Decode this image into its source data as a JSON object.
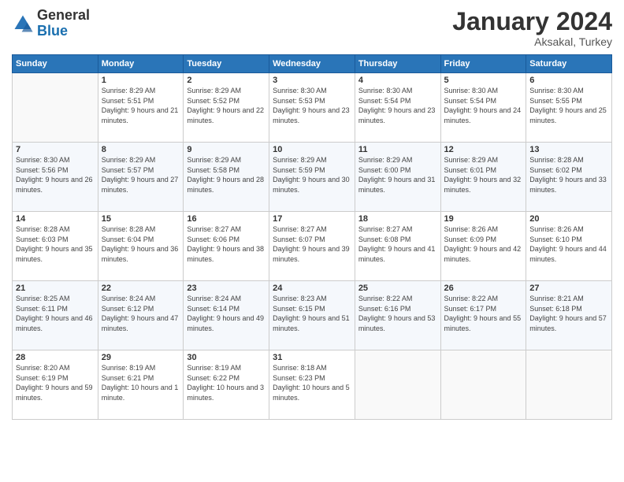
{
  "logo": {
    "general": "General",
    "blue": "Blue"
  },
  "header": {
    "month": "January 2024",
    "location": "Aksakal, Turkey"
  },
  "weekdays": [
    "Sunday",
    "Monday",
    "Tuesday",
    "Wednesday",
    "Thursday",
    "Friday",
    "Saturday"
  ],
  "weeks": [
    [
      {
        "day": "",
        "sunrise": "",
        "sunset": "",
        "daylight": ""
      },
      {
        "day": "1",
        "sunrise": "Sunrise: 8:29 AM",
        "sunset": "Sunset: 5:51 PM",
        "daylight": "Daylight: 9 hours and 21 minutes."
      },
      {
        "day": "2",
        "sunrise": "Sunrise: 8:29 AM",
        "sunset": "Sunset: 5:52 PM",
        "daylight": "Daylight: 9 hours and 22 minutes."
      },
      {
        "day": "3",
        "sunrise": "Sunrise: 8:30 AM",
        "sunset": "Sunset: 5:53 PM",
        "daylight": "Daylight: 9 hours and 23 minutes."
      },
      {
        "day": "4",
        "sunrise": "Sunrise: 8:30 AM",
        "sunset": "Sunset: 5:54 PM",
        "daylight": "Daylight: 9 hours and 23 minutes."
      },
      {
        "day": "5",
        "sunrise": "Sunrise: 8:30 AM",
        "sunset": "Sunset: 5:54 PM",
        "daylight": "Daylight: 9 hours and 24 minutes."
      },
      {
        "day": "6",
        "sunrise": "Sunrise: 8:30 AM",
        "sunset": "Sunset: 5:55 PM",
        "daylight": "Daylight: 9 hours and 25 minutes."
      }
    ],
    [
      {
        "day": "7",
        "sunrise": "Sunrise: 8:30 AM",
        "sunset": "Sunset: 5:56 PM",
        "daylight": "Daylight: 9 hours and 26 minutes."
      },
      {
        "day": "8",
        "sunrise": "Sunrise: 8:29 AM",
        "sunset": "Sunset: 5:57 PM",
        "daylight": "Daylight: 9 hours and 27 minutes."
      },
      {
        "day": "9",
        "sunrise": "Sunrise: 8:29 AM",
        "sunset": "Sunset: 5:58 PM",
        "daylight": "Daylight: 9 hours and 28 minutes."
      },
      {
        "day": "10",
        "sunrise": "Sunrise: 8:29 AM",
        "sunset": "Sunset: 5:59 PM",
        "daylight": "Daylight: 9 hours and 30 minutes."
      },
      {
        "day": "11",
        "sunrise": "Sunrise: 8:29 AM",
        "sunset": "Sunset: 6:00 PM",
        "daylight": "Daylight: 9 hours and 31 minutes."
      },
      {
        "day": "12",
        "sunrise": "Sunrise: 8:29 AM",
        "sunset": "Sunset: 6:01 PM",
        "daylight": "Daylight: 9 hours and 32 minutes."
      },
      {
        "day": "13",
        "sunrise": "Sunrise: 8:28 AM",
        "sunset": "Sunset: 6:02 PM",
        "daylight": "Daylight: 9 hours and 33 minutes."
      }
    ],
    [
      {
        "day": "14",
        "sunrise": "Sunrise: 8:28 AM",
        "sunset": "Sunset: 6:03 PM",
        "daylight": "Daylight: 9 hours and 35 minutes."
      },
      {
        "day": "15",
        "sunrise": "Sunrise: 8:28 AM",
        "sunset": "Sunset: 6:04 PM",
        "daylight": "Daylight: 9 hours and 36 minutes."
      },
      {
        "day": "16",
        "sunrise": "Sunrise: 8:27 AM",
        "sunset": "Sunset: 6:06 PM",
        "daylight": "Daylight: 9 hours and 38 minutes."
      },
      {
        "day": "17",
        "sunrise": "Sunrise: 8:27 AM",
        "sunset": "Sunset: 6:07 PM",
        "daylight": "Daylight: 9 hours and 39 minutes."
      },
      {
        "day": "18",
        "sunrise": "Sunrise: 8:27 AM",
        "sunset": "Sunset: 6:08 PM",
        "daylight": "Daylight: 9 hours and 41 minutes."
      },
      {
        "day": "19",
        "sunrise": "Sunrise: 8:26 AM",
        "sunset": "Sunset: 6:09 PM",
        "daylight": "Daylight: 9 hours and 42 minutes."
      },
      {
        "day": "20",
        "sunrise": "Sunrise: 8:26 AM",
        "sunset": "Sunset: 6:10 PM",
        "daylight": "Daylight: 9 hours and 44 minutes."
      }
    ],
    [
      {
        "day": "21",
        "sunrise": "Sunrise: 8:25 AM",
        "sunset": "Sunset: 6:11 PM",
        "daylight": "Daylight: 9 hours and 46 minutes."
      },
      {
        "day": "22",
        "sunrise": "Sunrise: 8:24 AM",
        "sunset": "Sunset: 6:12 PM",
        "daylight": "Daylight: 9 hours and 47 minutes."
      },
      {
        "day": "23",
        "sunrise": "Sunrise: 8:24 AM",
        "sunset": "Sunset: 6:14 PM",
        "daylight": "Daylight: 9 hours and 49 minutes."
      },
      {
        "day": "24",
        "sunrise": "Sunrise: 8:23 AM",
        "sunset": "Sunset: 6:15 PM",
        "daylight": "Daylight: 9 hours and 51 minutes."
      },
      {
        "day": "25",
        "sunrise": "Sunrise: 8:22 AM",
        "sunset": "Sunset: 6:16 PM",
        "daylight": "Daylight: 9 hours and 53 minutes."
      },
      {
        "day": "26",
        "sunrise": "Sunrise: 8:22 AM",
        "sunset": "Sunset: 6:17 PM",
        "daylight": "Daylight: 9 hours and 55 minutes."
      },
      {
        "day": "27",
        "sunrise": "Sunrise: 8:21 AM",
        "sunset": "Sunset: 6:18 PM",
        "daylight": "Daylight: 9 hours and 57 minutes."
      }
    ],
    [
      {
        "day": "28",
        "sunrise": "Sunrise: 8:20 AM",
        "sunset": "Sunset: 6:19 PM",
        "daylight": "Daylight: 9 hours and 59 minutes."
      },
      {
        "day": "29",
        "sunrise": "Sunrise: 8:19 AM",
        "sunset": "Sunset: 6:21 PM",
        "daylight": "Daylight: 10 hours and 1 minute."
      },
      {
        "day": "30",
        "sunrise": "Sunrise: 8:19 AM",
        "sunset": "Sunset: 6:22 PM",
        "daylight": "Daylight: 10 hours and 3 minutes."
      },
      {
        "day": "31",
        "sunrise": "Sunrise: 8:18 AM",
        "sunset": "Sunset: 6:23 PM",
        "daylight": "Daylight: 10 hours and 5 minutes."
      },
      {
        "day": "",
        "sunrise": "",
        "sunset": "",
        "daylight": ""
      },
      {
        "day": "",
        "sunrise": "",
        "sunset": "",
        "daylight": ""
      },
      {
        "day": "",
        "sunrise": "",
        "sunset": "",
        "daylight": ""
      }
    ]
  ]
}
